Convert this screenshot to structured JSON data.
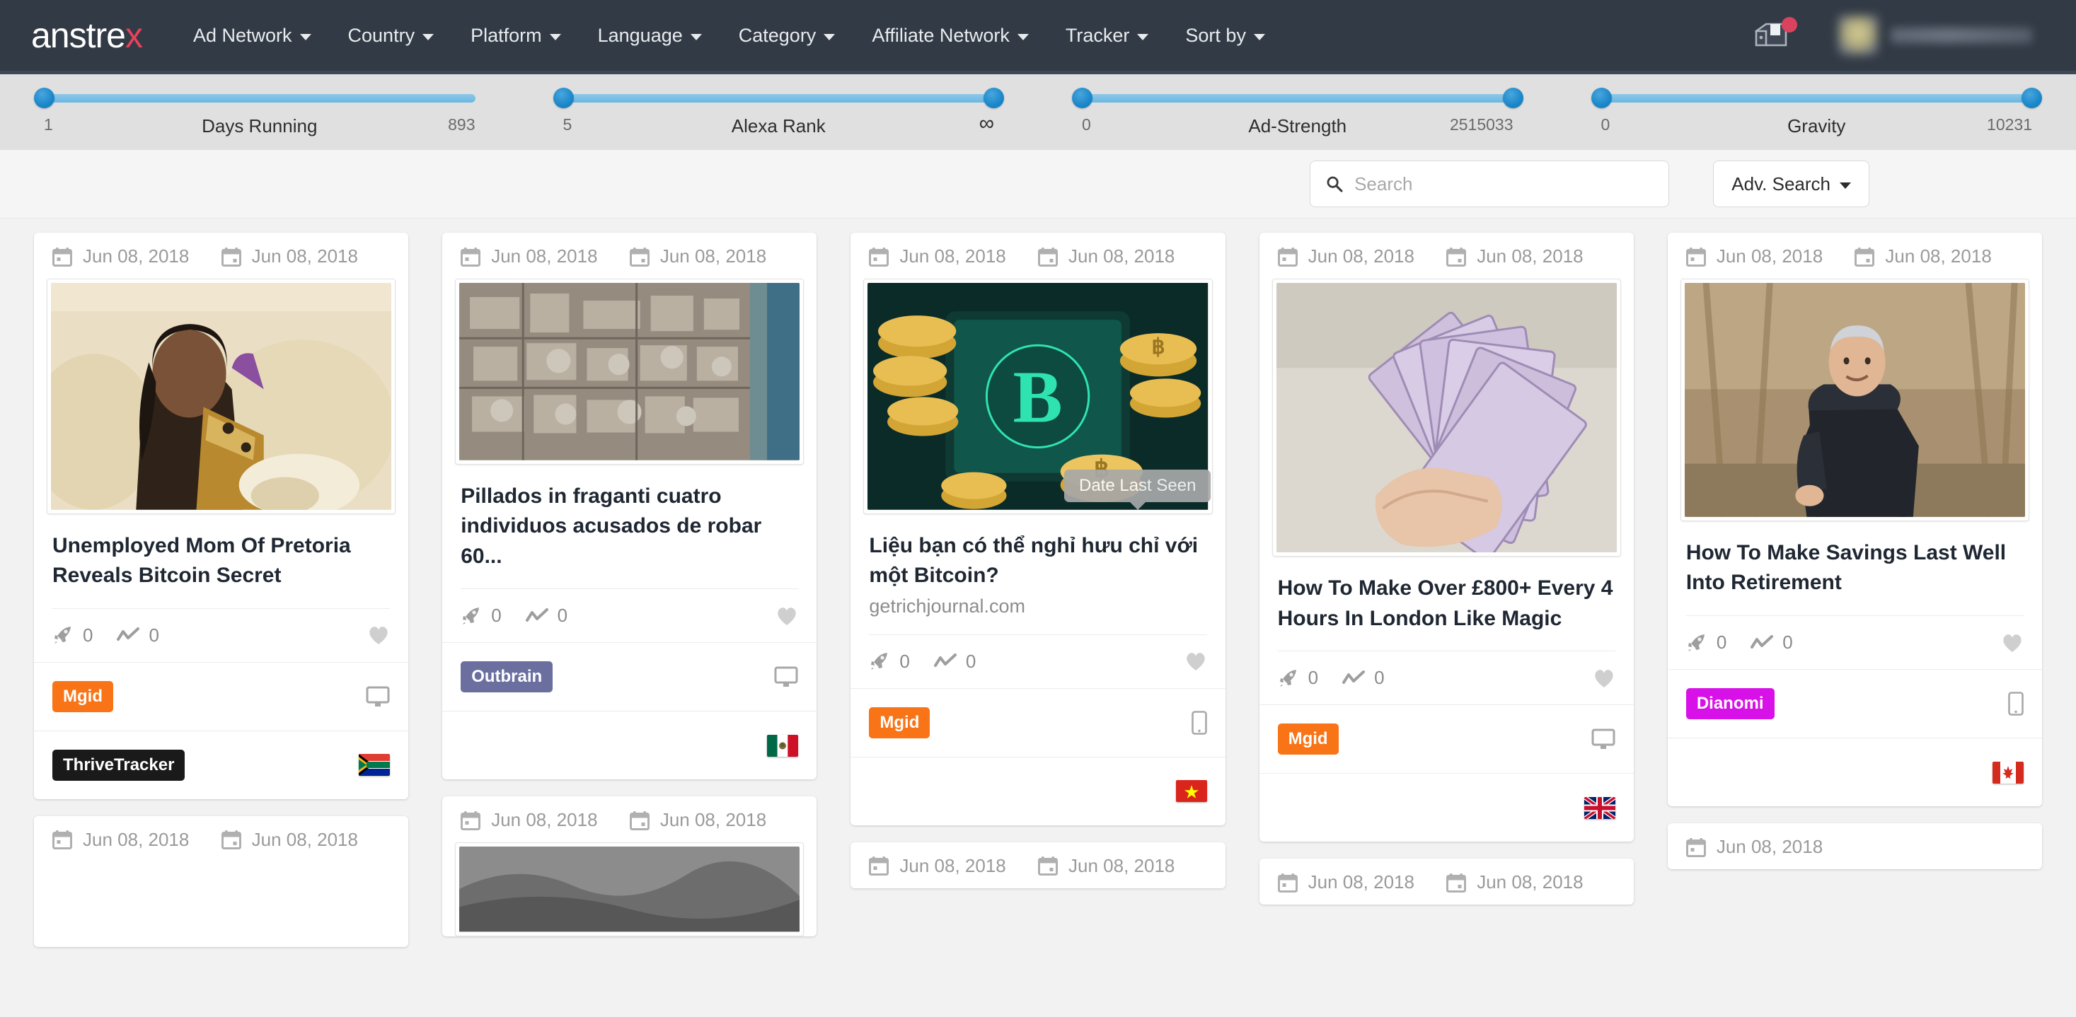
{
  "navbar": {
    "logo_text": "anstrex",
    "logo_accent_color": "#e8415c",
    "items": [
      {
        "label": "Ad Network"
      },
      {
        "label": "Country"
      },
      {
        "label": "Platform"
      },
      {
        "label": "Language"
      },
      {
        "label": "Category"
      },
      {
        "label": "Affiliate Network"
      },
      {
        "label": "Tracker"
      },
      {
        "label": "Sort by"
      }
    ],
    "mailbox_icon": "mailbox-icon",
    "notification_badge": "",
    "avatar": "user-avatar",
    "username": ""
  },
  "filters": {
    "sliders": [
      {
        "name": "Days Running",
        "min": "1",
        "max": "893",
        "left_pct": 0,
        "right_pct": 100,
        "handles": "left"
      },
      {
        "name": "Alexa Rank",
        "min": "5",
        "max": "∞",
        "left_pct": 0,
        "right_pct": 100,
        "handles": "both"
      },
      {
        "name": "Ad-Strength",
        "min": "0",
        "max": "2515033",
        "left_pct": 0,
        "right_pct": 100,
        "handles": "both"
      },
      {
        "name": "Gravity",
        "min": "0",
        "max": "10231",
        "left_pct": 0,
        "right_pct": 100,
        "handles": "both"
      }
    ]
  },
  "search": {
    "placeholder": "Search",
    "value": "",
    "icon": "search-icon",
    "adv_label": "Adv. Search"
  },
  "tooltip": {
    "text": "Date Last Seen"
  },
  "cards": [
    {
      "id": "card-1",
      "date_first": "Jun 08, 2018",
      "date_last": "Jun 08, 2018",
      "title": "Unemployed Mom Of Pretoria Reveals Bitcoin Secret",
      "domain": "",
      "gravity": "0",
      "strength": "0",
      "network": "Mgid",
      "network_color": "#f87416",
      "device": "desktop",
      "tracker": "ThriveTracker",
      "tracker_color": "#1a1a1a",
      "country": "South Africa",
      "country_code": "ZA",
      "image": "unemployed-mom-photo"
    },
    {
      "id": "card-2",
      "date_first": "Jun 08, 2018",
      "date_last": "Jun 08, 2018",
      "title": "Pillados in fraganti cuatro individuos acusados de robar 60...",
      "domain": "",
      "gravity": "0",
      "strength": "0",
      "network": "Outbrain",
      "network_color": "#6a6fa0",
      "device": "desktop",
      "tracker": "",
      "tracker_color": "",
      "country": "Mexico",
      "country_code": "MX",
      "image": "aerial-city-photo"
    },
    {
      "id": "card-3",
      "date_first": "Jun 08, 2018",
      "date_last": "Jun 08, 2018",
      "title": "Liệu bạn có thể nghỉ hưu chỉ với một Bitcoin?",
      "domain": "getrichjournal.com",
      "gravity": "0",
      "strength": "0",
      "network": "Mgid",
      "network_color": "#f87416",
      "device": "mobile",
      "tracker": "",
      "tracker_color": "",
      "country": "Vietnam",
      "country_code": "VN",
      "image": "bitcoin-coins-photo"
    },
    {
      "id": "card-4",
      "date_first": "Jun 08, 2018",
      "date_last": "Jun 08, 2018",
      "title": "How To Make Over £800+ Every 4 Hours In London Like Magic",
      "domain": "",
      "gravity": "0",
      "strength": "0",
      "network": "Mgid",
      "network_color": "#f87416",
      "device": "desktop",
      "tracker": "",
      "tracker_color": "",
      "country": "United Kingdom",
      "country_code": "GB",
      "image": "cash-notes-photo"
    },
    {
      "id": "card-5",
      "date_first": "Jun 08, 2018",
      "date_last": "Jun 08, 2018",
      "title": "How To Make Savings Last Well Into Retirement",
      "domain": "",
      "gravity": "0",
      "strength": "0",
      "network": "Dianomi",
      "network_color": "#d811e8",
      "device": "mobile",
      "tracker": "",
      "tracker_color": "",
      "country": "Canada",
      "country_code": "CA",
      "image": "man-backpack-photo"
    }
  ],
  "next_row_cards": [
    {
      "id": "card-6",
      "date_first": "Jun 08, 2018",
      "date_last": "Jun 08, 2018"
    },
    {
      "id": "card-7",
      "date_first": "Jun 08, 2018",
      "date_last": "Jun 08, 2018"
    },
    {
      "id": "card-8",
      "date_first": "Jun 08, 2018",
      "date_last": "Jun 08, 2018"
    },
    {
      "id": "card-9",
      "date_first": "Jun 08, 2018",
      "date_last": "Jun 08, 2018"
    }
  ]
}
